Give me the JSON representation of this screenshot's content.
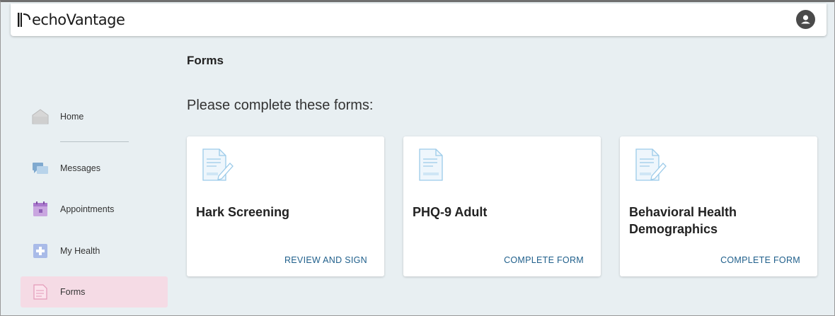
{
  "app": {
    "logo_text": "echoVantage"
  },
  "header": {
    "avatar_icon": "user-icon"
  },
  "sidebar": {
    "items": [
      {
        "label": "Home",
        "icon": "home-icon"
      },
      {
        "label": "Messages",
        "icon": "messages-icon"
      },
      {
        "label": "Appointments",
        "icon": "calendar-icon"
      },
      {
        "label": "My Health",
        "icon": "health-plus-icon"
      },
      {
        "label": "Forms",
        "icon": "forms-icon",
        "active": true
      }
    ]
  },
  "main": {
    "title": "Forms",
    "subtitle": "Please complete these forms:",
    "cards": [
      {
        "name": "Hark Screening",
        "action": "REVIEW AND SIGN",
        "icon": "form-edit-icon"
      },
      {
        "name": "PHQ-9 Adult",
        "action": "COMPLETE FORM",
        "icon": "form-icon"
      },
      {
        "name": "Behavioral Health Demographics",
        "action": "COMPLETE FORM",
        "icon": "form-edit-icon"
      }
    ]
  },
  "colors": {
    "background": "#e8eff2",
    "active_nav": "#f5dbe5",
    "link": "#1f5f8b",
    "icon_light_blue": "#cfe6f5"
  }
}
